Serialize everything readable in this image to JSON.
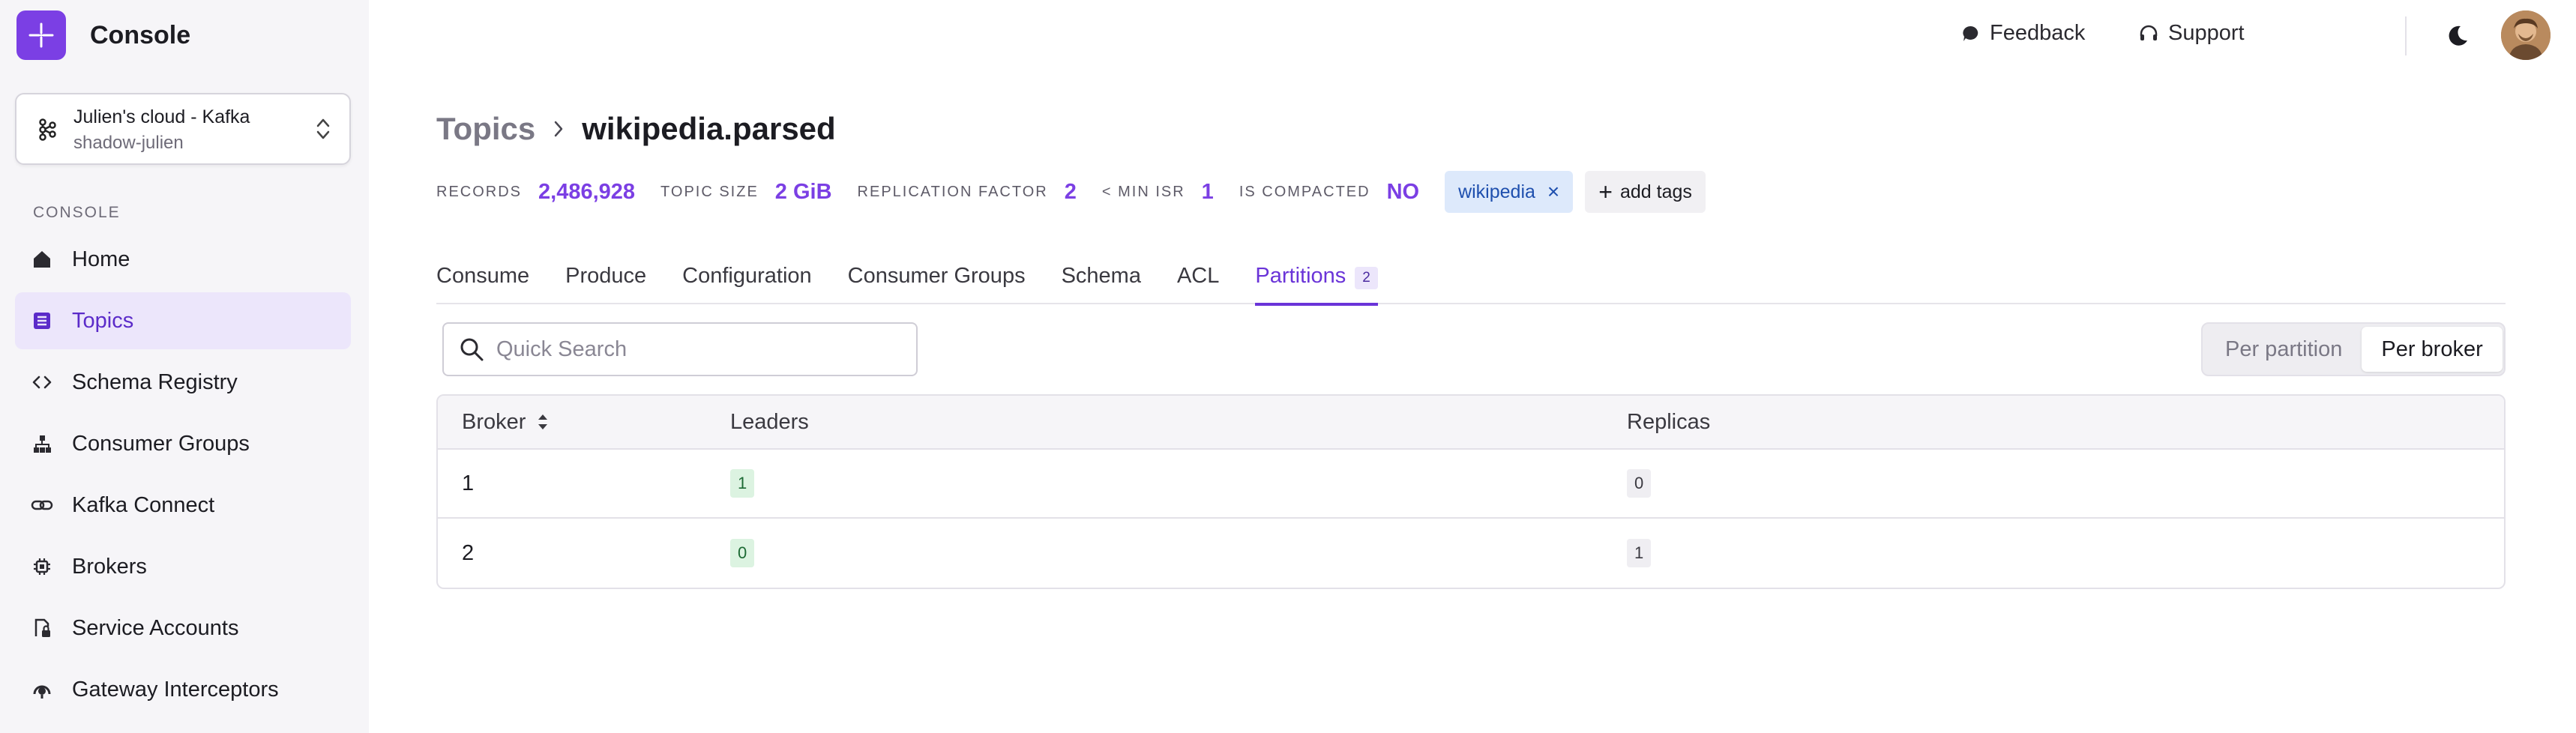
{
  "app": {
    "name": "Console"
  },
  "cluster": {
    "name": "Julien's cloud - Kafka",
    "subtitle": "shadow-julien"
  },
  "sidebar": {
    "section_label": "CONSOLE",
    "items": [
      {
        "label": "Home",
        "icon": "home-icon"
      },
      {
        "label": "Topics",
        "icon": "topics-icon",
        "active": true
      },
      {
        "label": "Schema Registry",
        "icon": "code-icon"
      },
      {
        "label": "Consumer Groups",
        "icon": "hierarchy-icon"
      },
      {
        "label": "Kafka Connect",
        "icon": "link-icon"
      },
      {
        "label": "Brokers",
        "icon": "chip-icon"
      },
      {
        "label": "Service Accounts",
        "icon": "lock-file-icon"
      },
      {
        "label": "Gateway Interceptors",
        "icon": "gateway-icon"
      }
    ]
  },
  "topbar": {
    "feedback": "Feedback",
    "support": "Support"
  },
  "breadcrumb": {
    "parent": "Topics",
    "current": "wikipedia.parsed"
  },
  "stats": {
    "records_label": "RECORDS",
    "records_value": "2,486,928",
    "size_label": "TOPIC SIZE",
    "size_value": "2 GiB",
    "replication_label": "REPLICATION FACTOR",
    "replication_value": "2",
    "min_isr_label": "< MIN ISR",
    "min_isr_value": "1",
    "compacted_label": "IS COMPACTED",
    "compacted_value": "NO"
  },
  "tags": {
    "items": [
      "wikipedia"
    ],
    "add_label": "add tags"
  },
  "tabs": [
    {
      "label": "Consume"
    },
    {
      "label": "Produce"
    },
    {
      "label": "Configuration"
    },
    {
      "label": "Consumer Groups"
    },
    {
      "label": "Schema"
    },
    {
      "label": "ACL"
    },
    {
      "label": "Partitions",
      "count": "2",
      "active": true
    }
  ],
  "search": {
    "placeholder": "Quick Search",
    "value": ""
  },
  "view_toggle": {
    "options": [
      "Per partition",
      "Per broker"
    ],
    "selected": "Per broker"
  },
  "table": {
    "columns": [
      "Broker",
      "Leaders",
      "Replicas"
    ],
    "rows": [
      {
        "broker": "1",
        "leaders": "1",
        "replicas": "0"
      },
      {
        "broker": "2",
        "leaders": "0",
        "replicas": "1"
      }
    ]
  },
  "colors": {
    "accent": "#7b3fe4",
    "tag_bg": "#dde9fb",
    "leader_badge": "#dcf3e1"
  }
}
